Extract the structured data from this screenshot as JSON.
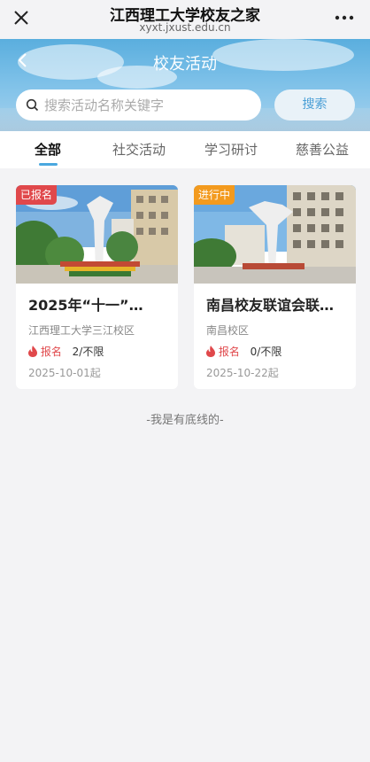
{
  "browser": {
    "title": "江西理工大学校友之家",
    "url": "xyxt.jxust.edu.cn",
    "close_icon": "close-icon",
    "more_icon": "more-icon"
  },
  "header": {
    "title": "校友活动",
    "back_icon": "chevron-left-icon"
  },
  "search": {
    "placeholder": "搜索活动名称关键字",
    "value": "",
    "button_label": "搜索"
  },
  "tabs": [
    {
      "label": "全部",
      "active": true
    },
    {
      "label": "社交活动",
      "active": false
    },
    {
      "label": "学习研讨",
      "active": false
    },
    {
      "label": "慈善公益",
      "active": false
    }
  ],
  "activities": [
    {
      "badge": "已报名",
      "badge_color": "#e0484b",
      "name": "2025年“十一”…",
      "location": "江西理工大学三江校区",
      "reg_label": "报名",
      "reg_count": "2/不限",
      "date": "2025-10-01起"
    },
    {
      "badge": "进行中",
      "badge_color": "#f39a1e",
      "name": "南昌校友联谊会联…",
      "location": "南昌校区",
      "reg_label": "报名",
      "reg_count": "0/不限",
      "date": "2025-10-22起"
    }
  ],
  "footer": {
    "note": "-我是有底线的-"
  },
  "colors": {
    "accent": "#4aa8df",
    "registered": "#e0484b",
    "in_progress": "#f39a1e"
  }
}
